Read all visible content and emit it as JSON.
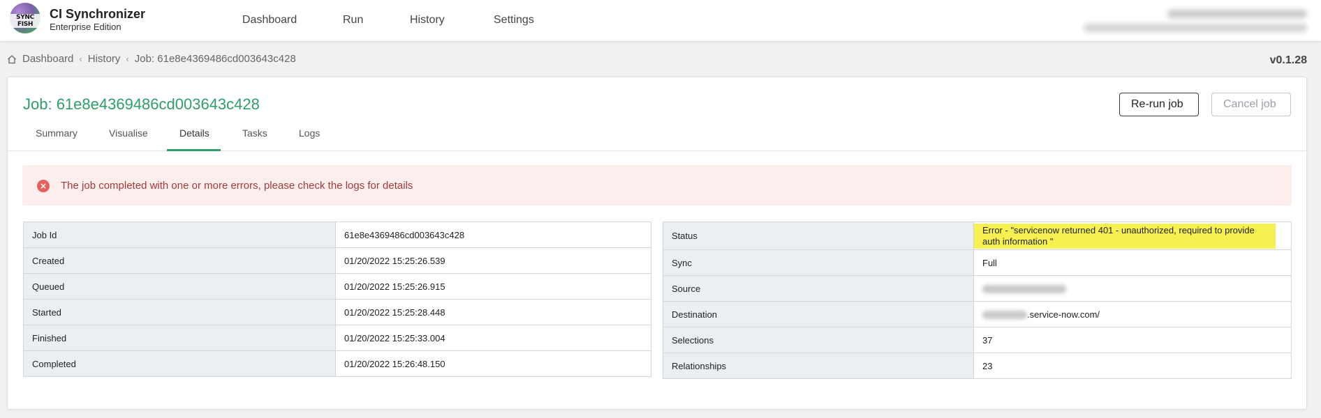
{
  "app": {
    "logo_text": "SYNC FISH",
    "title": "CI Synchronizer",
    "subtitle": "Enterprise Edition"
  },
  "nav": [
    "Dashboard",
    "Run",
    "History",
    "Settings"
  ],
  "breadcrumb": [
    "Dashboard",
    "History",
    "Job: 61e8e4369486cd003643c428"
  ],
  "version": "v0.1.28",
  "job": {
    "title": "Job: 61e8e4369486cd003643c428",
    "rerun_label": "Re-run job",
    "cancel_label": "Cancel job"
  },
  "tabs": [
    "Summary",
    "Visualise",
    "Details",
    "Tasks",
    "Logs"
  ],
  "active_tab": "Details",
  "alert": "The job completed with one or more errors, please check the logs for details",
  "left_table": [
    {
      "k": "Job Id",
      "v": "61e8e4369486cd003643c428"
    },
    {
      "k": "Created",
      "v": "01/20/2022 15:25:26.539"
    },
    {
      "k": "Queued",
      "v": "01/20/2022 15:25:26.915"
    },
    {
      "k": "Started",
      "v": "01/20/2022 15:25:28.448"
    },
    {
      "k": "Finished",
      "v": "01/20/2022 15:25:33.004"
    },
    {
      "k": "Completed",
      "v": "01/20/2022 15:26:48.150"
    }
  ],
  "right_table": [
    {
      "k": "Status",
      "v": "Error - \"servicenow returned 401 - unauthorized, required to provide auth information \""
    },
    {
      "k": "Sync",
      "v": "Full"
    },
    {
      "k": "Source",
      "v": ""
    },
    {
      "k": "Destination",
      "v": ".service-now.com/"
    },
    {
      "k": "Selections",
      "v": "37"
    },
    {
      "k": "Relationships",
      "v": "23"
    }
  ],
  "colors": {
    "accent": "#2e9e6b",
    "error_bg": "#fdeeee",
    "error_text": "#a33a3a",
    "highlight": "#f6f150"
  }
}
